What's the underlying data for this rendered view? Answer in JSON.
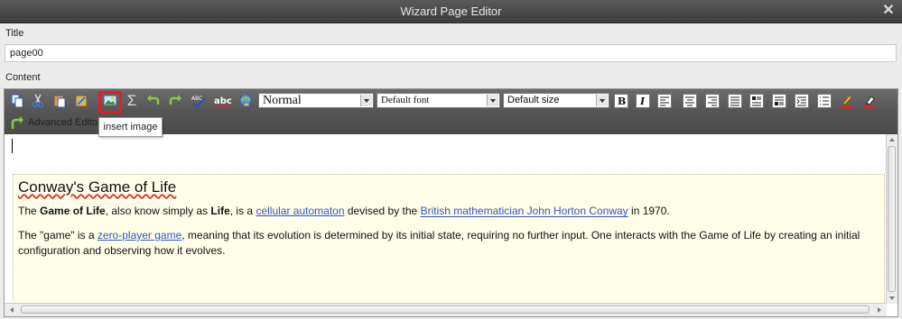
{
  "window": {
    "title": "Wizard Page Editor"
  },
  "form": {
    "title_label": "Title",
    "title_value": "page00",
    "content_label": "Content"
  },
  "toolbar": {
    "style_select": "Normal",
    "font_select": "Default font",
    "size_select": "Default size",
    "advanced_editor": "Advanced Editor",
    "tooltip": "insert image",
    "icons": [
      "copy-icon",
      "cut-icon",
      "paste-icon",
      "paste-special-icon",
      "insert-image-icon",
      "sum-icon",
      "undo-icon",
      "redo-icon",
      "spellcheck-icon",
      "spelling-abc-icon",
      "insert-link-icon",
      "bold-icon",
      "italic-icon",
      "align-left-icon",
      "align-center-icon",
      "align-right-icon",
      "justify-icon",
      "ordered-list-icon",
      "unordered-list-icon",
      "indent-icon",
      "list-icon",
      "text-color-icon",
      "highlight-icon"
    ],
    "highlight_color": "#e41e26"
  },
  "document": {
    "heading": "Conway's Game of Life",
    "p1": {
      "t1": "The ",
      "b1": "Game of Life",
      "t2": ", also know simply as ",
      "b2": "Life",
      "t3": ", is a ",
      "link1": "cellular automaton",
      "t4": " devised by the ",
      "link2": "British mathematician John Horton Conway",
      "t5": " in 1970."
    },
    "p2": {
      "t1": "The \"game\" is a ",
      "link1": "zero-player game",
      "t2": ", meaning that its evolution is determined by its initial state, requiring no further input. One interacts with the Game of Life by creating an initial configuration and observing how it evolves."
    },
    "link_color": "#3355cc",
    "background_color": "#fffee8"
  }
}
